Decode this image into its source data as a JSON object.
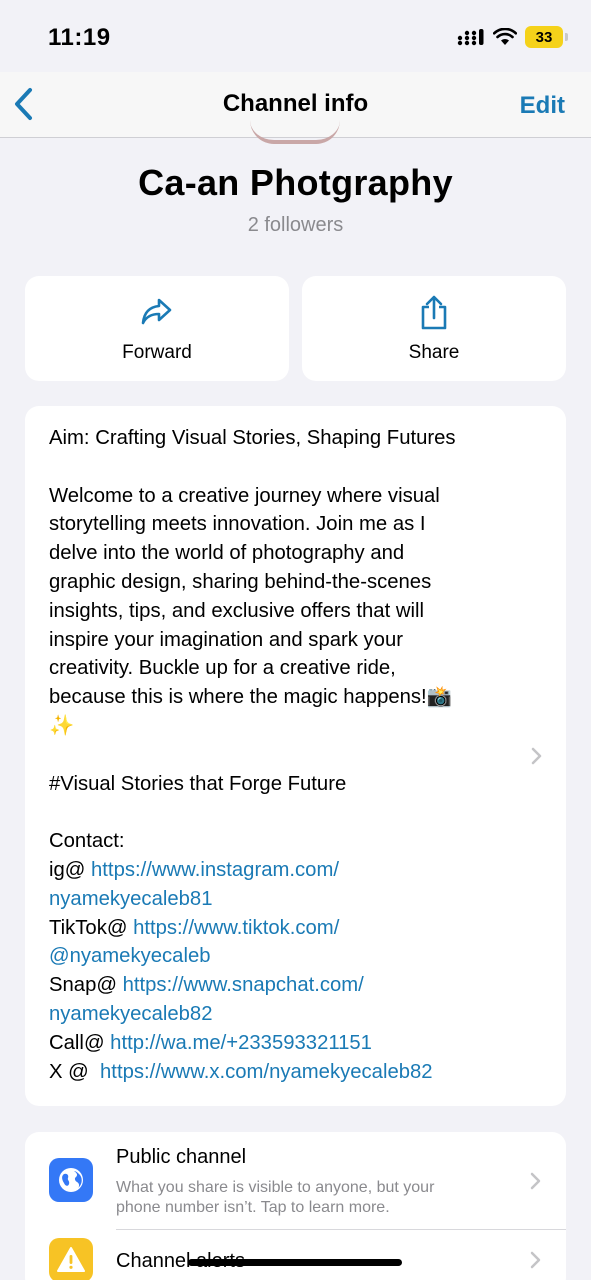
{
  "status_bar": {
    "time": "11:19",
    "battery": "33"
  },
  "nav": {
    "title": "Channel info",
    "edit_label": "Edit"
  },
  "channel": {
    "name": "Ca-an Photgraphy",
    "followers": "2 followers"
  },
  "actions": [
    {
      "label": "Forward",
      "icon": "forward-arrow-icon"
    },
    {
      "label": "Share",
      "icon": "share-icon"
    }
  ],
  "description": {
    "aim": "Aim: Crafting Visual Stories, Shaping Futures",
    "welcome_lines": [
      "Welcome to a creative journey where visual",
      "storytelling meets innovation. Join me as I",
      "delve into the world of photography and",
      "graphic design, sharing behind-the-scenes",
      "insights, tips, and exclusive offers that will",
      "inspire your imagination and spark your",
      "creativity. Buckle up for a creative ride,",
      "because this is where the magic happens!📸",
      "✨"
    ],
    "hashtag": "#Visual Stories that Forge Future",
    "contact_heading": "Contact:",
    "contacts": [
      {
        "prefix": "ig@ ",
        "link_line1": "https://www.instagram.com/",
        "link_line2": "nyamekyecaleb81"
      },
      {
        "prefix": "TikTok@ ",
        "link_line1": "https://www.tiktok.com/",
        "link_line2": "@nyamekyecaleb"
      },
      {
        "prefix": "Snap@ ",
        "link_line1": "https://www.snapchat.com/",
        "link_line2": "nyamekyecaleb82"
      },
      {
        "prefix": "Call@ ",
        "link_line1": "http://wa.me/+233593321151",
        "link_line2": ""
      },
      {
        "prefix": "X @  ",
        "link_line1": "https://www.x.com/nyamekyecaleb82",
        "link_line2": ""
      }
    ]
  },
  "settings": [
    {
      "title": "Public channel",
      "subtitle_line1": "What you share is visible to anyone, but your",
      "subtitle_line2": "phone number isn’t. Tap to learn more.",
      "icon": "globe-icon",
      "color": "#3478f6"
    },
    {
      "title": "Channel alerts",
      "icon": "warning-icon",
      "color": "#f7c325"
    }
  ],
  "colors": {
    "accent": "#1a7ab5",
    "background": "#f2f2f7"
  }
}
